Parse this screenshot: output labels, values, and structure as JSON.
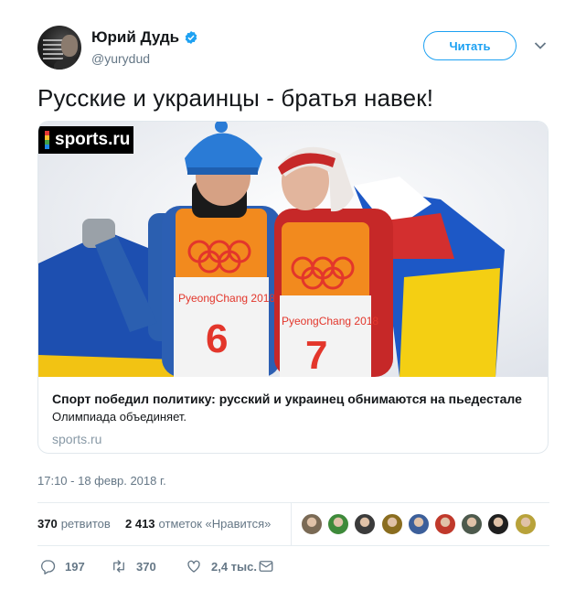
{
  "author": {
    "display_name": "Юрий Дудь",
    "handle": "@yurydud",
    "avatar_icon": "profile-photo",
    "verified_icon": "verified-badge-icon"
  },
  "follow_button": {
    "label": "Читать"
  },
  "caret_icon": "chevron-down-icon",
  "tweet": {
    "text": "Русские и украинцы - братья навек!"
  },
  "card": {
    "logo_text": "sports.ru",
    "image_icon": "olympic-athletes-photo",
    "title": "Спорт победил политику: русский и украинец обнимаются на пьедестале",
    "description": "Олимпиада объединяет.",
    "domain": "sports.ru"
  },
  "timestamp": "17:10 - 18 февр. 2018 г.",
  "stats": {
    "retweets_count": "370",
    "retweets_label": "ретвитов",
    "likes_count": "2 413",
    "likes_label": "отметок «Нравится»"
  },
  "liker_avatars": [
    {
      "color": "#7a6a55"
    },
    {
      "color": "#3e8a3a"
    },
    {
      "color": "#3b3b3b"
    },
    {
      "color": "#8a6d1f"
    },
    {
      "color": "#3c5f9a"
    },
    {
      "color": "#c0392b"
    },
    {
      "color": "#4d5a4d"
    },
    {
      "color": "#1f1f1f"
    },
    {
      "color": "#b8a23a"
    }
  ],
  "actions": {
    "reply_count": "197",
    "retweet_count": "370",
    "like_count": "2,4 тыс.",
    "reply_icon": "reply-icon",
    "retweet_icon": "retweet-icon",
    "like_icon": "heart-icon",
    "message_icon": "envelope-icon"
  },
  "colors": {
    "accent": "#1da1f2",
    "muted_text": "#657786",
    "border": "#e1e8ed"
  }
}
